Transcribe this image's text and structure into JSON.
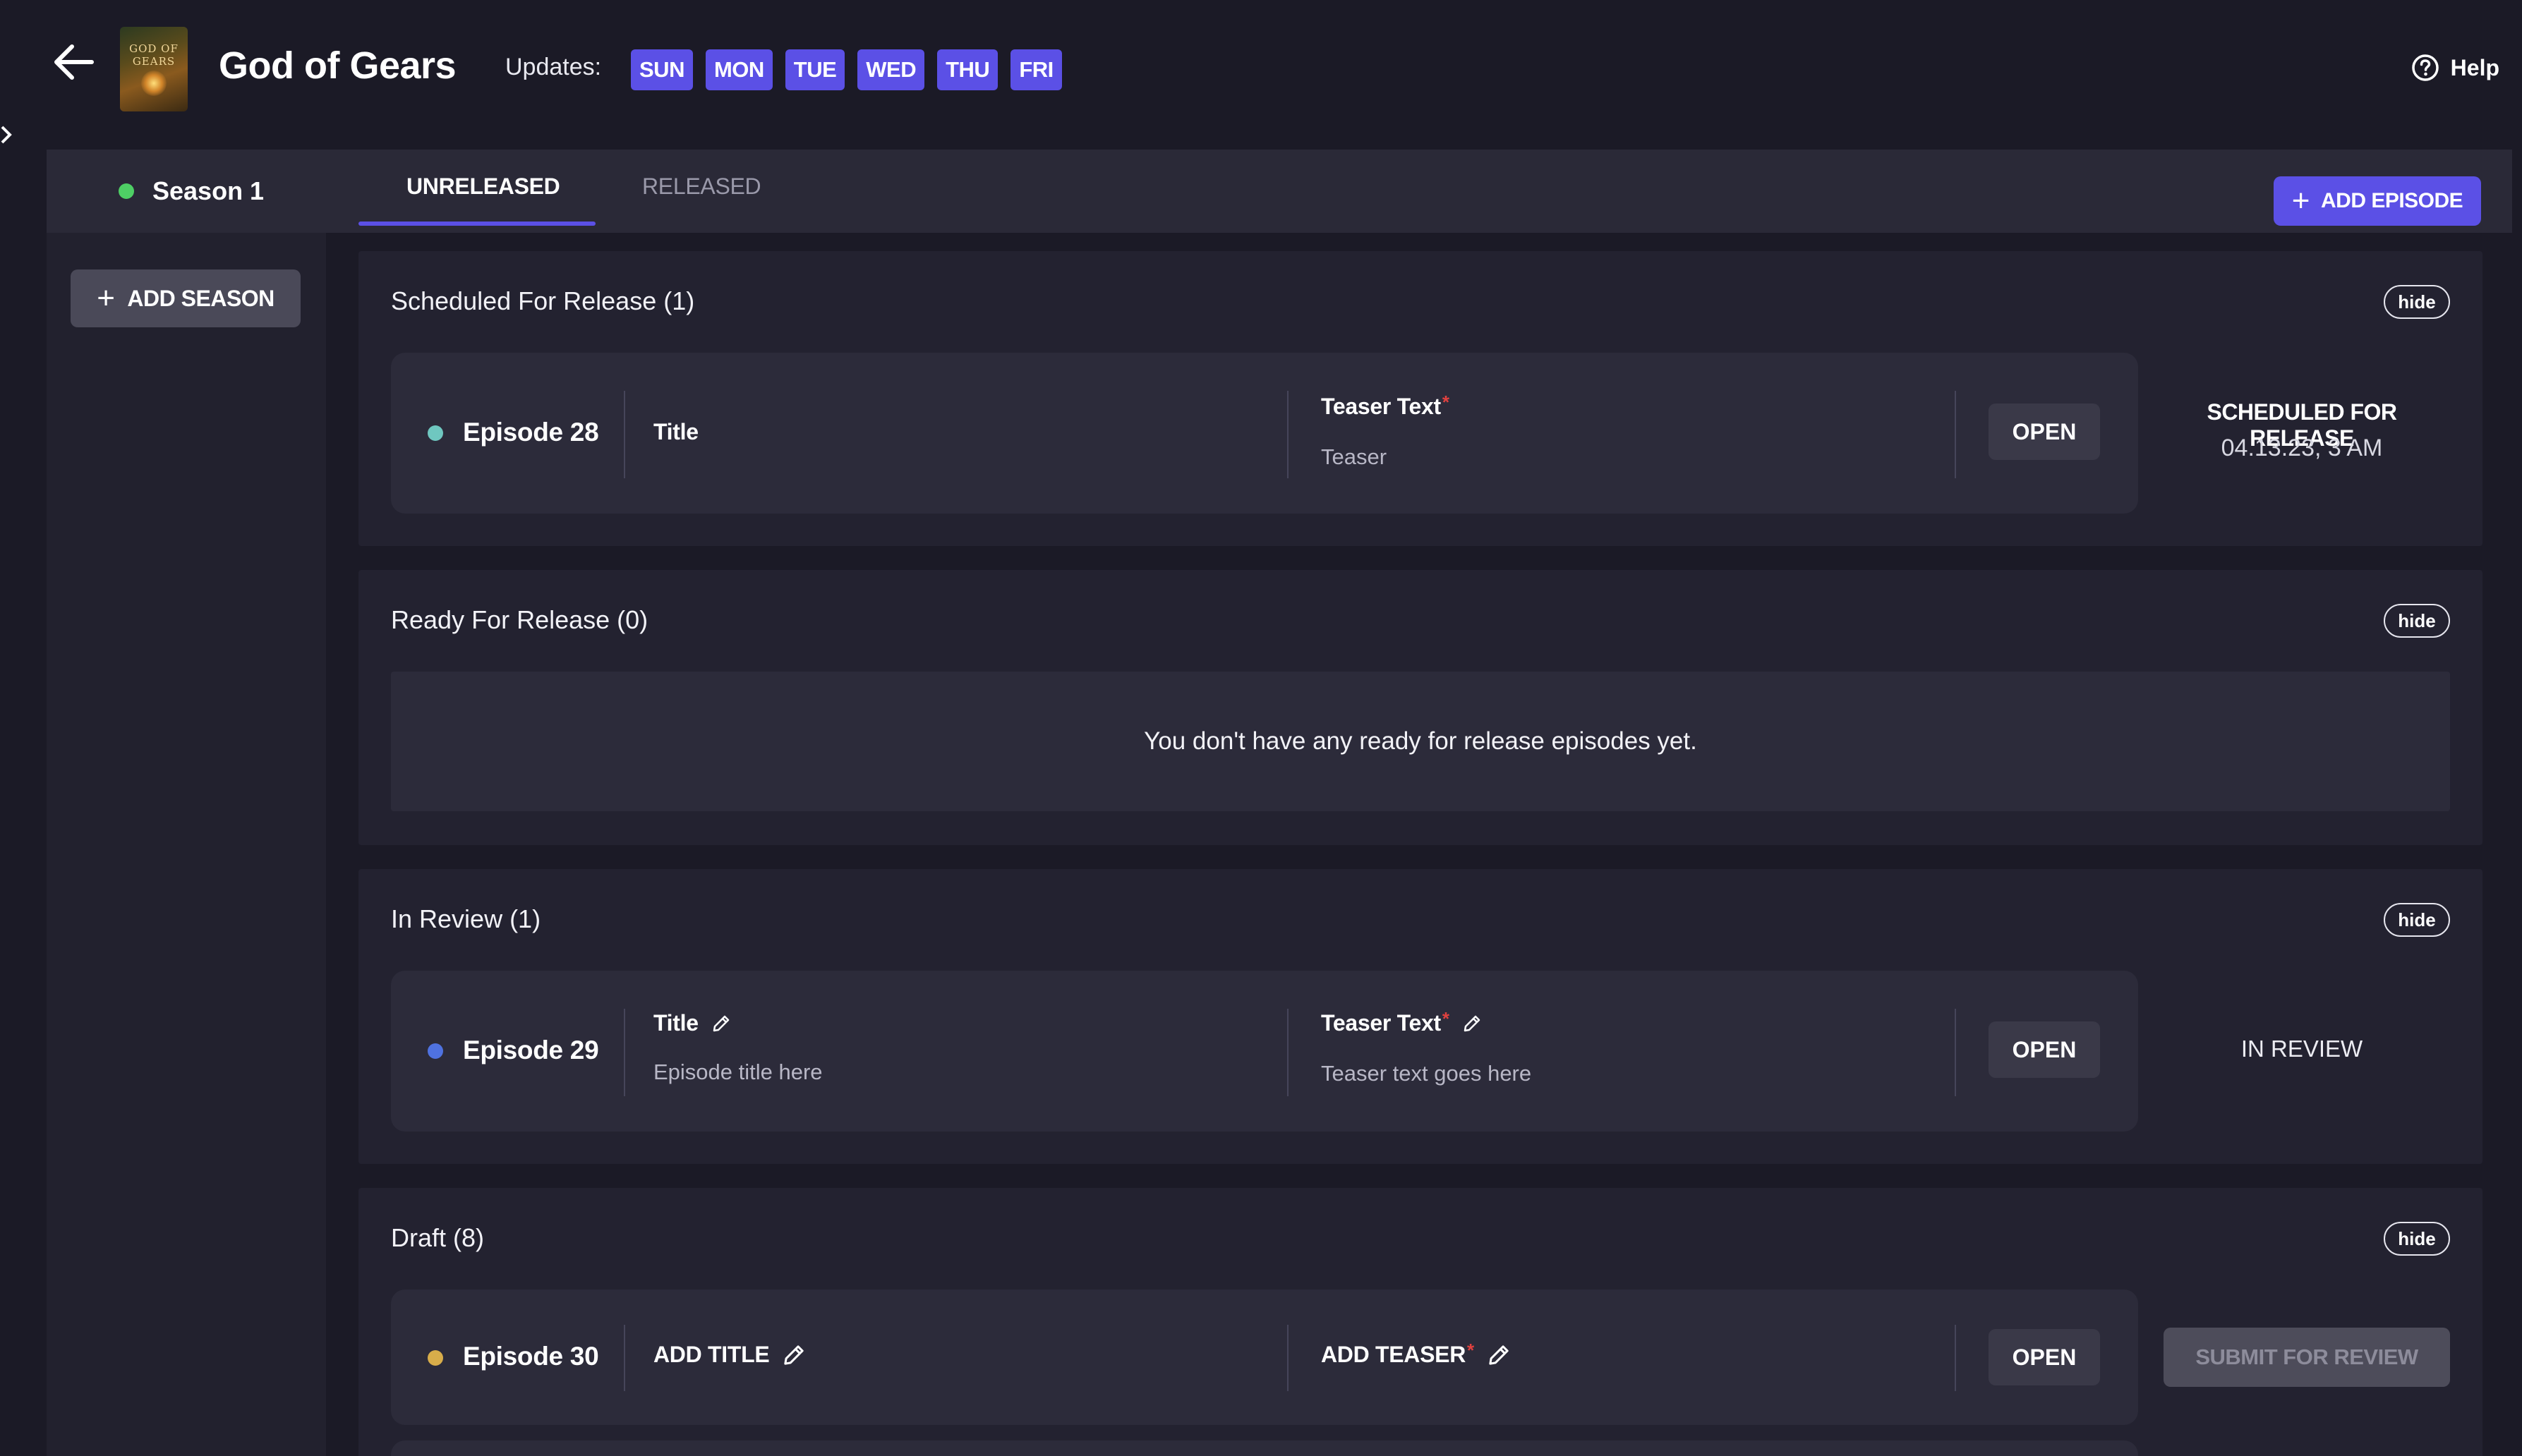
{
  "header": {
    "title": "God of Gears",
    "cover_text": "GOD OF GEARS",
    "updates_label": "Updates:",
    "days": [
      "SUN",
      "MON",
      "TUE",
      "WED",
      "THU",
      "FRI"
    ],
    "help_label": "Help"
  },
  "sidebar": {
    "season_label": "Season 1",
    "add_season_label": "ADD SEASON"
  },
  "tabs": [
    {
      "label": "UNRELEASED",
      "active": true
    },
    {
      "label": "RELEASED",
      "active": false
    }
  ],
  "toolbar": {
    "add_episode_label": "ADD EPISODE"
  },
  "sections": {
    "scheduled": {
      "title": "Scheduled For Release (1)",
      "hide_label": "hide",
      "episode": {
        "name": "Episode 28",
        "dot_color": "#6fc7c0",
        "title_label": "Title",
        "teaser_label": "Teaser Text",
        "required_mark": "*",
        "teaser_value": "Teaser",
        "open_label": "OPEN",
        "status": "SCHEDULED FOR RELEASE",
        "status_date": "04.13.23, 3 AM"
      }
    },
    "ready": {
      "title": "Ready For Release (0)",
      "hide_label": "hide",
      "empty_message": "You don't have any ready for release episodes yet."
    },
    "review": {
      "title": "In Review (1)",
      "hide_label": "hide",
      "episode": {
        "name": "Episode 29",
        "dot_color": "#4f72e0",
        "title_label": "Title",
        "title_value": "Episode title here",
        "teaser_label": "Teaser Text",
        "required_mark": "*",
        "teaser_value": "Teaser text goes here",
        "open_label": "OPEN",
        "status": "IN REVIEW"
      }
    },
    "draft": {
      "title": "Draft (8)",
      "hide_label": "hide",
      "episode": {
        "name": "Episode 30",
        "dot_color": "#d8ad4a",
        "title_label": "ADD TITLE",
        "teaser_label": "ADD TEASER",
        "required_mark": "*",
        "open_label": "OPEN",
        "submit_label": "SUBMIT FOR REVIEW"
      }
    }
  },
  "colors": {
    "accent": "#5b50e6",
    "background": "#1b1a26",
    "season_status": "#4ecf65",
    "required": "#e0413f"
  }
}
